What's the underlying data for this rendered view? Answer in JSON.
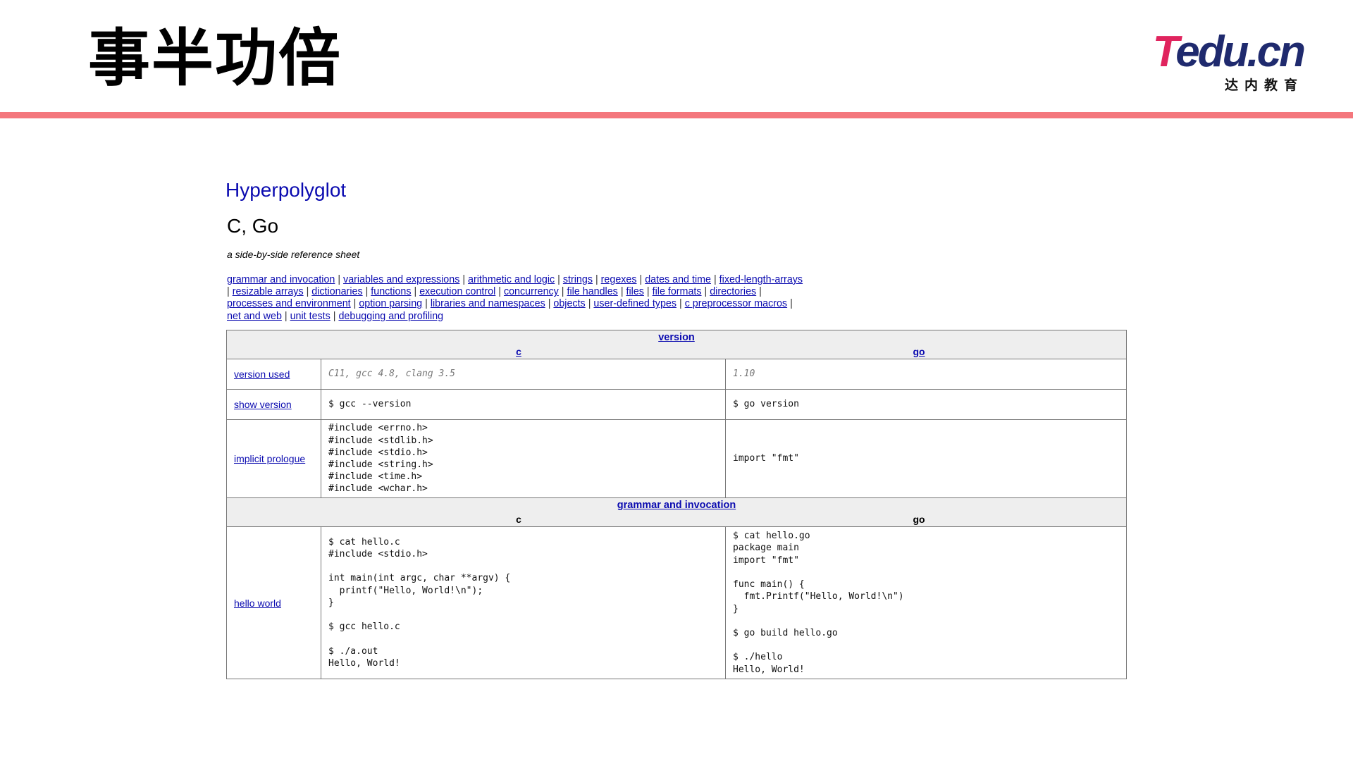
{
  "slide": {
    "title": "事半功倍",
    "logo": {
      "word_t": "T",
      "word_rest": "edu.cn",
      "subtitle": "达内教育"
    },
    "accent_color": "#f4777d"
  },
  "doc": {
    "site_title": "Hyperpolyglot",
    "heading": "C, Go",
    "subtitle": "a side-by-side reference sheet",
    "toc_links": [
      "grammar and invocation",
      "variables and expressions",
      "arithmetic and logic",
      "strings",
      "regexes",
      "dates and time",
      "fixed-length-arrays",
      "resizable arrays",
      "dictionaries",
      "functions",
      "execution control",
      "concurrency",
      "file handles",
      "files",
      "file formats",
      "directories",
      "processes and environment",
      "option parsing",
      "libraries and namespaces",
      "objects",
      "user-defined types",
      "c preprocessor macros",
      "net and web",
      "unit tests",
      "debugging and profiling"
    ],
    "table": {
      "section_version": {
        "title": "version",
        "lang1": "c",
        "lang2": "go"
      },
      "rows_version": [
        {
          "label": "version used",
          "c": "C11, gcc 4.8, clang 3.5",
          "go": "1.10"
        },
        {
          "label": "show version",
          "c": "$ gcc --version",
          "go": "$ go version"
        },
        {
          "label": "implicit prologue",
          "c": "#include <errno.h>\n#include <stdlib.h>\n#include <stdio.h>\n#include <string.h>\n#include <time.h>\n#include <wchar.h>",
          "go": "import \"fmt\""
        }
      ],
      "section_grammar": {
        "title": "grammar and invocation",
        "lang1": "c",
        "lang2": "go"
      },
      "rows_grammar": [
        {
          "label": "hello world",
          "c": "$ cat hello.c\n#include <stdio.h>\n\nint main(int argc, char **argv) {\n  printf(\"Hello, World!\\n\");\n}\n\n$ gcc hello.c\n\n$ ./a.out\nHello, World!",
          "go": "$ cat hello.go\npackage main\nimport \"fmt\"\n\nfunc main() {\n  fmt.Printf(\"Hello, World!\\n\")\n}\n\n$ go build hello.go\n\n$ ./hello\nHello, World!"
        }
      ]
    }
  }
}
